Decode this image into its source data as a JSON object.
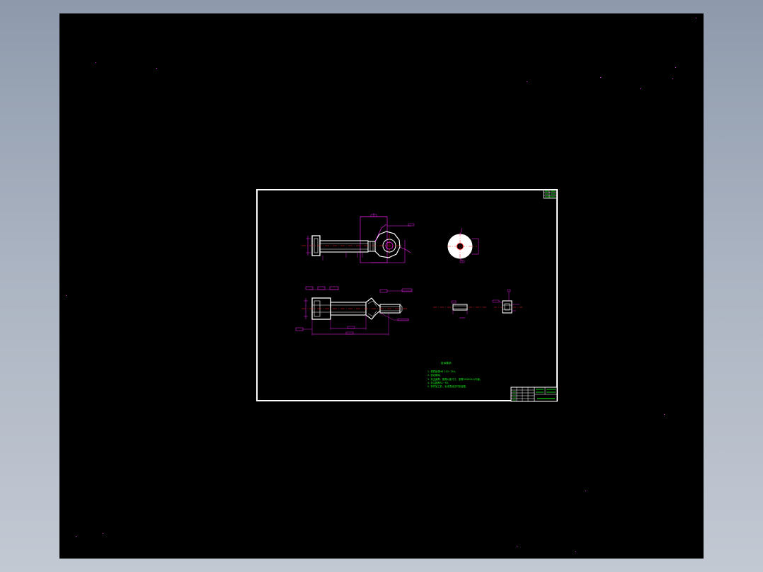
{
  "app": {
    "background_top": "#8e9aac",
    "background_bottom": "#c3c9d3",
    "canvas_color": "#000000",
    "frame_color": "#ffffff",
    "dimension_color": "#ff22ff",
    "text_color": "#19ff19",
    "part_color": "#ffffff",
    "centerline_color": "#ff2020"
  },
  "drawing": {
    "technical_requirements": {
      "title": "技术要求",
      "items": [
        "1. 调质处理HB 220~250。",
        "2. 锐边倒钝。",
        "3. 未注倒角，按照公差尺寸，按照GB1804-f/中级。",
        "4. 未注圆角R1~R3。",
        "5. 零件加工前，毛坯须经过时效处理。"
      ]
    }
  }
}
